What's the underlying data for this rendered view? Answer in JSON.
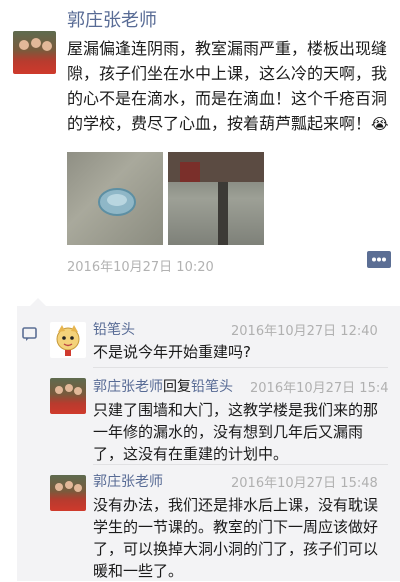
{
  "post": {
    "author": "郭庄张老师",
    "text": "屋漏偏逢连阴雨，教室漏雨严重，楼板出现缝隙，孩子们坐在水中上课，这么冷的天啊，我的心不是在滴水，而是在滴血！这个千疮百洞的学校，费尽了心血，按着葫芦瓢起来啊！",
    "timestamp": "2016年10月27日 10:20",
    "emoji": "😭"
  },
  "comments": [
    {
      "author": "铅笔头",
      "timestamp": "2016年10月27日 12:40",
      "text": "不是说今年开始重建吗?"
    },
    {
      "author": "郭庄张老师",
      "reply_word": "回复",
      "reply_to": "铅笔头",
      "timestamp": "2016年10月27日 15:4",
      "text": "只建了围墙和大门，这教学楼是我们来的那一年修的漏水的，没有想到几年后又漏雨了，这没有在重建的计划中。"
    },
    {
      "author": "郭庄张老师",
      "timestamp": "2016年10月27日 15:48",
      "text": "没有办法，我们还是排水后上课，没有耽误学生的一节课的。教室的门下一周应该做好了，可以换掉大洞小洞的门了，孩子们可以暖和一些了。"
    }
  ],
  "icons": {
    "more": "more-dots-icon",
    "comment": "comment-icon",
    "emoji": "crying-emoji-icon"
  }
}
